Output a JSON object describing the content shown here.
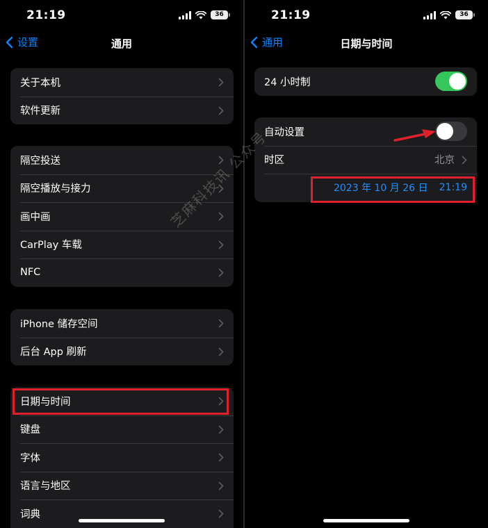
{
  "left": {
    "status": {
      "time": "21:19",
      "battery": "36"
    },
    "nav": {
      "back": "设置",
      "title": "通用"
    },
    "groups": [
      [
        "关于本机",
        "软件更新"
      ],
      [
        "隔空投送",
        "隔空播放与接力",
        "画中画",
        "CarPlay 车载",
        "NFC"
      ],
      [
        "iPhone 储存空间",
        "后台 App 刷新"
      ],
      [
        "日期与时间",
        "键盘",
        "字体",
        "语言与地区",
        "词典"
      ]
    ]
  },
  "right": {
    "status": {
      "time": "21:19",
      "battery": "36"
    },
    "nav": {
      "back": "通用",
      "title": "日期与时间"
    },
    "hour24": {
      "label": "24 小时制",
      "on": true
    },
    "auto": {
      "label": "自动设置",
      "on": false
    },
    "timezone": {
      "label": "时区",
      "value": "北京"
    },
    "datetime": {
      "date": "2023 年 10 月 26 日",
      "time": "21:19"
    }
  },
  "watermark": "芝麻科技讯 公众号",
  "colors": {
    "accent": "#0a84ff",
    "highlight": "#e0202b",
    "toggle_on": "#34c759"
  }
}
